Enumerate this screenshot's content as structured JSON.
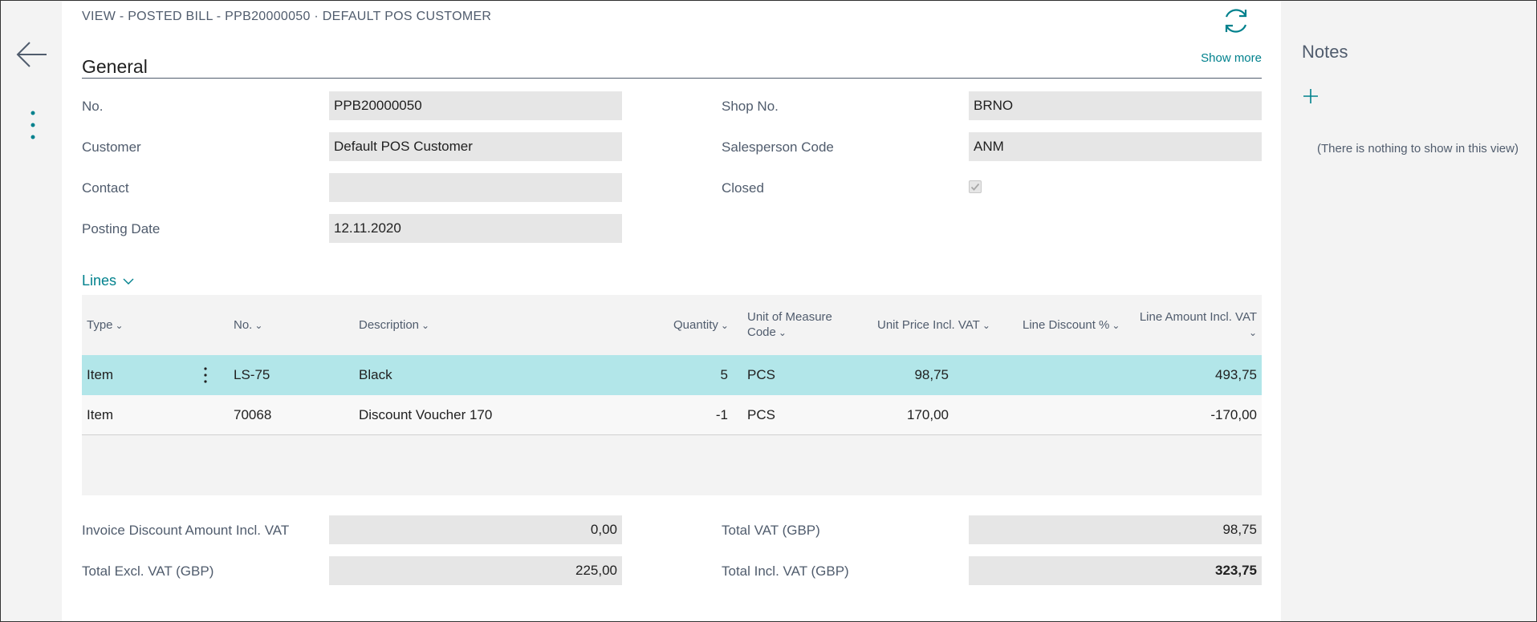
{
  "breadcrumb": "VIEW - POSTED BILL - PPB20000050 · DEFAULT POS CUSTOMER",
  "actions": {
    "show_more": "Show more"
  },
  "general": {
    "title": "General",
    "fields": {
      "no": {
        "label": "No.",
        "value": "PPB20000050"
      },
      "customer": {
        "label": "Customer",
        "value": "Default POS Customer"
      },
      "contact": {
        "label": "Contact",
        "value": ""
      },
      "posting_date": {
        "label": "Posting Date",
        "value": "12.11.2020"
      },
      "shop_no": {
        "label": "Shop No.",
        "value": "BRNO"
      },
      "salesperson_code": {
        "label": "Salesperson Code",
        "value": "ANM"
      },
      "closed": {
        "label": "Closed",
        "checked": true
      }
    }
  },
  "lines": {
    "title": "Lines",
    "columns": {
      "type": "Type",
      "no": "No.",
      "description": "Description",
      "quantity": "Quantity",
      "uom": "Unit of Measure Code",
      "uom_l1": "Unit of Measure",
      "uom_l2": "Code",
      "unit_price": "Unit Price Incl. VAT",
      "line_discount": "Line Discount %",
      "line_amount": "Line Amount Incl. VAT"
    },
    "rows": [
      {
        "type": "Item",
        "no": "LS-75",
        "description": "Black",
        "quantity": "5",
        "uom": "PCS",
        "unit_price": "98,75",
        "line_discount": "",
        "line_amount": "493,75"
      },
      {
        "type": "Item",
        "no": "70068",
        "description": "Discount Voucher 170",
        "quantity": "-1",
        "uom": "PCS",
        "unit_price": "170,00",
        "line_discount": "",
        "line_amount": "-170,00"
      }
    ]
  },
  "totals": {
    "invoice_discount": {
      "label": "Invoice Discount Amount Incl. VAT",
      "value": "0,00"
    },
    "total_excl_vat": {
      "label": "Total Excl. VAT (GBP)",
      "value": "225,00"
    },
    "total_vat": {
      "label": "Total VAT (GBP)",
      "value": "98,75"
    },
    "total_incl_vat": {
      "label": "Total Incl. VAT (GBP)",
      "value": "323,75"
    }
  },
  "notes": {
    "title": "Notes",
    "empty_text": "(There is nothing to show in this view)"
  },
  "colors": {
    "accent": "#00818d",
    "selected_row": "#b2e6e9",
    "field_bg": "#e6e6e6"
  },
  "icons": [
    "back-arrow-icon",
    "more-vertical-icon",
    "refresh-icon",
    "chevron-down-icon",
    "plus-icon"
  ]
}
